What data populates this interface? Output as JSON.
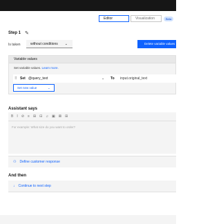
{
  "mode_switch": {
    "editor": "Editor",
    "visualization": "Visualization",
    "badge": "Beta"
  },
  "step": {
    "title": "Step 1",
    "edit_icon": "pencil-icon"
  },
  "condition": {
    "label": "Is taken",
    "value": "without conditions"
  },
  "delete_button": "Delete variable values",
  "variables": {
    "title": "Variable values",
    "description": "Set variable values.",
    "learn_more": "Learn more.",
    "row": {
      "set": "Set",
      "variable": "@query_text",
      "to": "To",
      "value": "input.original_text"
    },
    "set_new_value": "Set new value"
  },
  "assistant": {
    "title": "Assistant says",
    "toolbar": [
      "B",
      "I",
      "⊘",
      "≡",
      "⊞",
      "⊟",
      "♫",
      "▣",
      "⊠",
      "⊞"
    ],
    "placeholder": "For example: What size do you want to order?"
  },
  "define_response": "Define customer response",
  "and_then": {
    "title": "And then",
    "action": "Continue to next step"
  },
  "colors": {
    "accent": "#0f62fe",
    "topbar": "#161616",
    "panel": "#f4f4f4"
  }
}
